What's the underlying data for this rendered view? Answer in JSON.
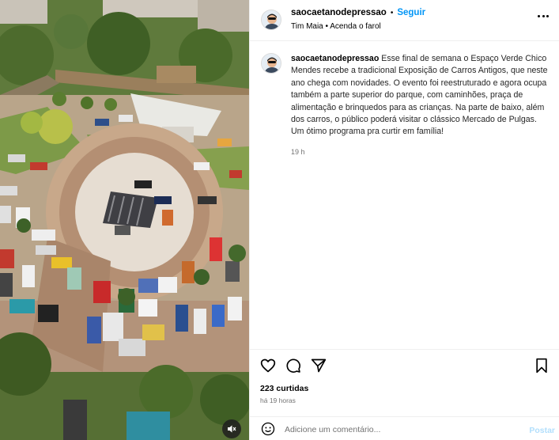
{
  "header": {
    "username": "saocaetanodepressao",
    "separator": "•",
    "follow_label": "Seguir",
    "audio": "Tim Maia • Acenda o farol",
    "more_icon": "more-options-icon"
  },
  "caption": {
    "username": "saocaetanodepressao",
    "text": "Esse final de semana o Espaço Verde Chico Mendes recebe a tradicional Exposição de Carros Antigos, que neste ano chega com novidades. O evento foi reestruturado e agora ocupa também a parte superior do parque, com caminhões, praça de alimentação e brinquedos para as crianças. Na parte de baixo, além dos carros, o público poderá visitar o clássico Mercado de Pulgas. Um ótimo programa pra curtir em família!",
    "time": "19 h"
  },
  "actions": {
    "like_icon": "heart-icon",
    "comment_icon": "comment-icon",
    "share_icon": "share-icon",
    "save_icon": "bookmark-icon"
  },
  "likes": "223 curtidas",
  "posted_ago": "há 19 horas",
  "comment_box": {
    "placeholder": "Adicione um comentário...",
    "post_label": "Postar",
    "emoji_icon": "emoji-icon"
  },
  "media": {
    "mute_icon": "muted-speaker-icon"
  },
  "colors": {
    "accent": "#0095f6",
    "disabled_accent": "#b2dffc",
    "secondary_text": "#737373",
    "divider": "#efefef"
  }
}
